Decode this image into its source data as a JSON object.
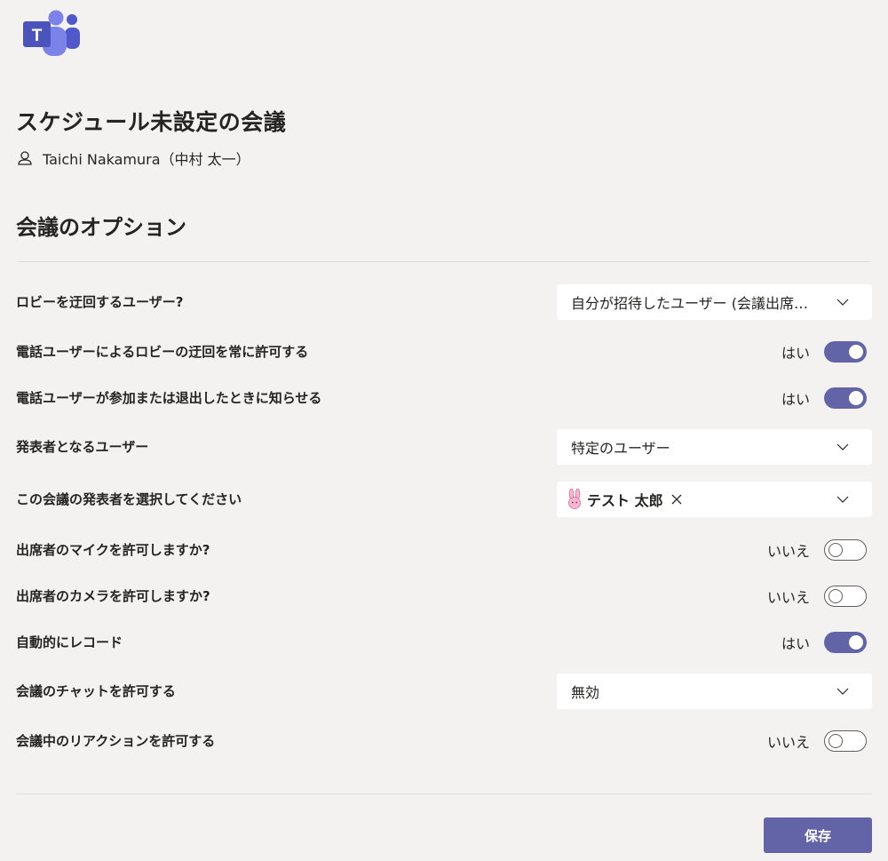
{
  "app": {
    "logo_icon": "teams-logo-icon",
    "logo_letter": "T"
  },
  "meeting": {
    "title": "スケジュール未設定の会議",
    "organizer": "Taichi Nakamura（中村 太一）",
    "organizer_icon": "person-icon"
  },
  "options": {
    "title": "会議のオプション",
    "bypass_lobby": {
      "label": "ロビーを迂回するユーザー?",
      "value": "自分が招待したユーザー (会議出席依..."
    },
    "dialin_bypass": {
      "label": "電話ユーザーによるロビーの迂回を常に許可する",
      "value_text": "はい",
      "on": true
    },
    "join_leave_notify": {
      "label": "電話ユーザーが参加または退出したときに知らせる",
      "value_text": "はい",
      "on": true
    },
    "presenters": {
      "label": "発表者となるユーザー",
      "value": "特定のユーザー"
    },
    "select_presenters": {
      "label": "この会議の発表者を選択してください",
      "chip_name": "テスト 太郎",
      "chip_avatar_icon": "bunny-avatar-icon",
      "chip_remove_icon": "close-icon"
    },
    "attendee_mic": {
      "label": "出席者のマイクを許可しますか?",
      "value_text": "いいえ",
      "on": false
    },
    "attendee_camera": {
      "label": "出席者のカメラを許可しますか?",
      "value_text": "いいえ",
      "on": false
    },
    "auto_record": {
      "label": "自動的にレコード",
      "value_text": "はい",
      "on": true
    },
    "meeting_chat": {
      "label": "会議のチャットを許可する",
      "value": "無効"
    },
    "reactions": {
      "label": "会議中のリアクションを許可する",
      "value_text": "いいえ",
      "on": false
    }
  },
  "footer": {
    "save_label": "保存"
  },
  "colors": {
    "background": "#f3f2f1",
    "accent": "#6264a7",
    "text": "#252423",
    "divider": "#e1dfdd"
  }
}
